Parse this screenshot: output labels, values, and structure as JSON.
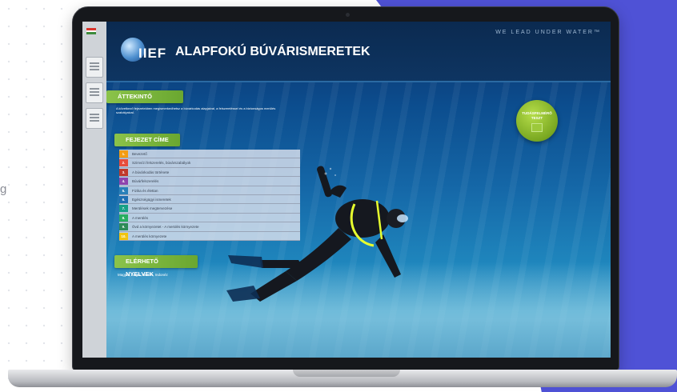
{
  "stray_text": "g",
  "app": {
    "tagline": "WE LEAD UNDER WATER™",
    "logo_text": "IIEF",
    "title": "ALAPFOKÚ BÚVÁRISMERETEK",
    "overview": {
      "label": "ÁTTEKINTŐ",
      "text": "A következő fejezetekben megismerkedhetsz a búvárkodás alapjaival, a felszereléssel és a biztonságos merülés szabályaival."
    },
    "chapters": {
      "label": "FEJEZET CÍME",
      "items": [
        {
          "num": "1.",
          "label": "Bevezető",
          "color": "#f39c12"
        },
        {
          "num": "2.",
          "label": "Szimvízi felszerelés, búvárszabályok",
          "color": "#e74c3c"
        },
        {
          "num": "3.",
          "label": "A búvárkodás története",
          "color": "#c0392b"
        },
        {
          "num": "4.",
          "label": "Búvárfelszerelés",
          "color": "#8e44ad"
        },
        {
          "num": "5.",
          "label": "Fizika és élettan",
          "color": "#2980b9"
        },
        {
          "num": "6.",
          "label": "Egészségügyi ismeretek",
          "color": "#1f6fb2"
        },
        {
          "num": "7.",
          "label": "Merülések megtervezése",
          "color": "#16a085"
        },
        {
          "num": "8.",
          "label": "A merülés",
          "color": "#27ae60"
        },
        {
          "num": "9.",
          "label": "Óvd a környezetet - A merülés környezete",
          "color": "#2e8b57"
        },
        {
          "num": "10.",
          "label": "A merülés környezete",
          "color": "#f1c40f"
        }
      ]
    },
    "languages": {
      "label": "ELÉRHETŐ NYELVEK",
      "text": "Magyar, Angol, Német, Indonéz"
    },
    "test_button": "TUDÁSFELMÉRŐ TESZT"
  },
  "colors": {
    "accent_green": "#8bc34a",
    "brand_purple": "#4f52d6",
    "header_navy": "#0b2a50"
  }
}
